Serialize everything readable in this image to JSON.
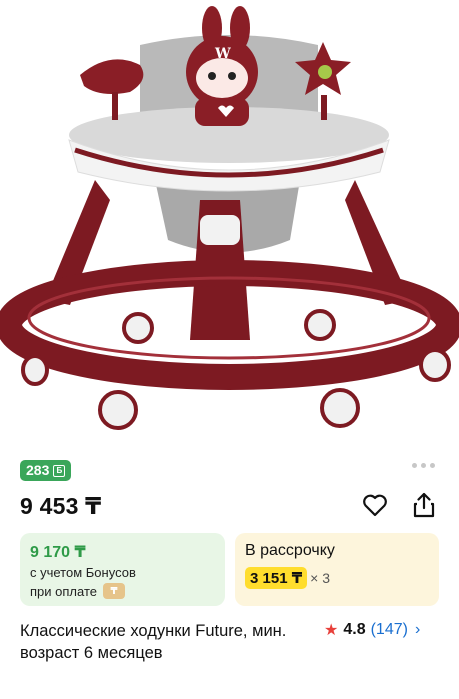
{
  "product": {
    "bonus_badge": "283",
    "bonus_icon": "Б",
    "price": "9 453 ₸",
    "title": "Классические ходунки Future, мин. возраст 6 месяцев",
    "rating": {
      "score": "4.8",
      "count": "(147)"
    }
  },
  "cards": {
    "bonus": {
      "price": "9 170 ₸",
      "line1": "с учетом Бонусов",
      "line2": "при оплате"
    },
    "installment": {
      "title": "В рассрочку",
      "amount": "3 151 ₸",
      "times": "× 3"
    }
  },
  "icons": {
    "favorite": "heart-icon",
    "share": "share-icon",
    "more": "more-dots-icon",
    "rating": "star-icon",
    "chevron": "chevron-right-icon",
    "payment": "payment-icon"
  },
  "colors": {
    "bonus_green": "#3aa65a",
    "green_card_bg": "#e8f6e6",
    "yellow_card_bg": "#fdf5dc",
    "installment_chip": "#ffdd2d",
    "rating_star": "#e8403b",
    "link_blue": "#1a6fd0",
    "walker_maroon": "#7d1a22"
  }
}
